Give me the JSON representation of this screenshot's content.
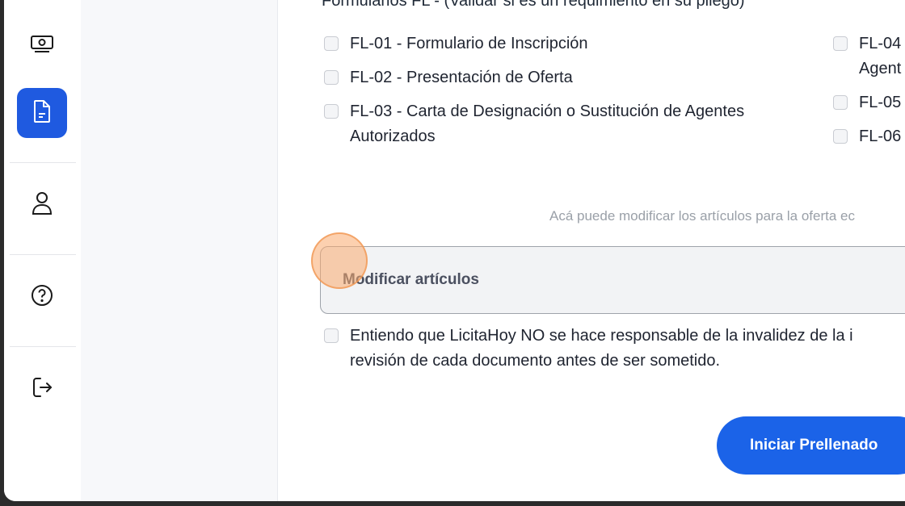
{
  "sidebar": {
    "items": [
      {
        "icon": "money-icon",
        "active": false
      },
      {
        "icon": "document-icon",
        "active": true
      },
      {
        "icon": "user-icon",
        "active": false
      },
      {
        "icon": "help-icon",
        "active": false
      },
      {
        "icon": "logout-icon",
        "active": false
      }
    ],
    "active_color": "#1f5ae0"
  },
  "forms": {
    "section_title": "Formularios FL - (Validar si es un requimiento en su pliego)",
    "left_column": [
      {
        "label": "FL-01 - Formulario de Inscripción",
        "checked": false
      },
      {
        "label": "FL-02 - Presentación de Oferta",
        "checked": false
      },
      {
        "label_line1": "FL-03 - Carta de Designación o Sustitución de Agentes",
        "label_line2": "Autorizados",
        "checked": false
      }
    ],
    "right_column": [
      {
        "label_line1": "FL-04",
        "label_line2": "Agent",
        "checked": false
      },
      {
        "label": "FL-05",
        "checked": false
      },
      {
        "label": "FL-06",
        "checked": false
      }
    ]
  },
  "articles": {
    "hint": "Acá puede modificar los artículos para la oferta ec",
    "modify_label": "Modificar artículos"
  },
  "disclaimer": {
    "line1": "Entiendo que LicitaHoy NO se hace responsable de la invalidez de la i",
    "line2": "revisión de cada documento antes de ser sometido.",
    "checked": false
  },
  "actions": {
    "start_label": "Iniciar Prellenado",
    "accent": "#1b63e8"
  }
}
